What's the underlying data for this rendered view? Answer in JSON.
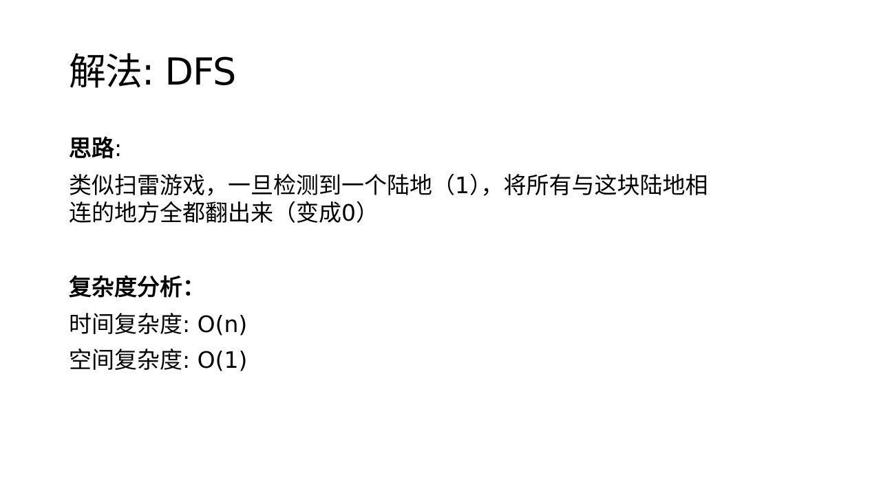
{
  "slide": {
    "title": "解法: DFS",
    "approach": {
      "heading": "思路",
      "colon": ":",
      "lines": [
        "类似扫雷游戏，一旦检测到一个陆地（1），将所有与这块陆地相",
        "连的地方全都翻出来（变成0）"
      ]
    },
    "complexity": {
      "heading": "复杂度分析：",
      "time": "时间复杂度: O(n)",
      "space": "空间复杂度: O(1)"
    }
  }
}
